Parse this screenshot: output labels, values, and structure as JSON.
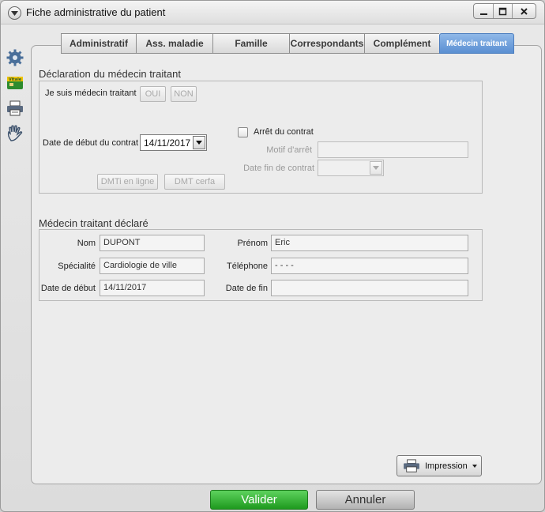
{
  "window": {
    "title": "Fiche administrative du patient",
    "controls": [
      "minimize-icon",
      "maximize-icon",
      "close-icon"
    ]
  },
  "left_toolbar": {
    "icons": [
      "gear-icon",
      "vitale-card-icon",
      "printer-icon",
      "hand-icon"
    ],
    "vitale_text": "Vitale"
  },
  "tabs": [
    {
      "label": "Administratif",
      "active": false
    },
    {
      "label": "Ass. maladie",
      "active": false
    },
    {
      "label": "Famille",
      "active": false
    },
    {
      "label": "Correspondants",
      "active": false
    },
    {
      "label": "Complément",
      "active": false
    },
    {
      "label": "Médecin traitant",
      "active": true
    }
  ],
  "declaration": {
    "title": "Déclaration du médecin traitant",
    "je_suis_label": "Je suis médecin traitant",
    "oui_label": "OUI",
    "non_label": "NON",
    "date_debut_label": "Date de début du contrat",
    "date_debut_value": "14/11/2017",
    "arret_label": "Arrêt du contrat",
    "arret_checked": false,
    "motif_label": "Motif d'arrêt",
    "motif_value": "",
    "date_fin_label": "Date fin de contrat",
    "date_fin_value": "",
    "dmti_label": "DMTi en ligne",
    "dmt_cerfa_label": "DMT cerfa"
  },
  "declared": {
    "title": "Médecin traitant déclaré",
    "nom_label": "Nom",
    "nom_value": "DUPONT",
    "prenom_label": "Prénom",
    "prenom_value": "Eric",
    "specialite_label": "Spécialité",
    "specialite_value": "Cardiologie de ville",
    "telephone_label": "Téléphone",
    "telephone_value": "- - - -",
    "date_debut_label": "Date de début",
    "date_debut_value": "14/11/2017",
    "date_fin_label": "Date de fin",
    "date_fin_value": ""
  },
  "actions": {
    "impression_label": "Impression",
    "valider_label": "Valider",
    "annuler_label": "Annuler"
  },
  "colors": {
    "active_tab": "#5a8fd2",
    "validate_button": "#1e9a1e"
  }
}
